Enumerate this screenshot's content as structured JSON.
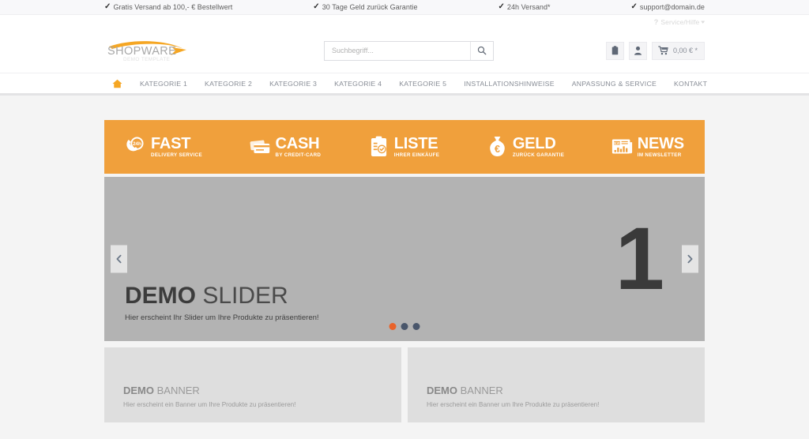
{
  "topbar": {
    "promos": [
      {
        "icon": "check-icon",
        "text": "Gratis Versand ab 100,- € Bestellwert"
      },
      {
        "icon": "check-icon",
        "text": "30 Tage Geld zurück Garantie"
      },
      {
        "icon": "check-icon",
        "text": "24h Versand*"
      },
      {
        "icon": "check-icon",
        "text": "support@domain.de"
      }
    ],
    "service_label": "Service/Hilfe",
    "service_icon": "question-mark-icon",
    "service_chevron": "chevron-down-icon"
  },
  "header": {
    "logo": {
      "name": "SHOPWARE",
      "tagline": "DEMO TEMPLATE",
      "accent": "#f5a623"
    },
    "search": {
      "placeholder": "Suchbegriff...",
      "value": "",
      "icon": "search-icon"
    },
    "actions": [
      {
        "icon": "note-clipboard-icon",
        "label": "Merkzettel"
      },
      {
        "icon": "user-account-icon",
        "label": "Mein Konto"
      }
    ],
    "cart": {
      "icon": "shopping-cart-icon",
      "amount": "0,00 € *"
    }
  },
  "nav": {
    "home_icon": "home-icon",
    "items": [
      {
        "label": "KATEGORIE 1"
      },
      {
        "label": "KATEGORIE 2"
      },
      {
        "label": "KATEGORIE 3"
      },
      {
        "label": "KATEGORIE 4"
      },
      {
        "label": "KATEGORIE 5"
      },
      {
        "label": "INSTALLATIONSHINWEISE"
      },
      {
        "label": "ANPASSUNG & SERVICE"
      },
      {
        "label": "KONTAKT"
      }
    ]
  },
  "benefits": {
    "background": "#f0a03c",
    "items": [
      {
        "icon": "phone-24h-icon",
        "title": "FAST",
        "subtitle": "DELIVERY SERVICE"
      },
      {
        "icon": "credit-card-icon",
        "title": "CASH",
        "subtitle": "BY CREDIT-CARD"
      },
      {
        "icon": "clipboard-check-icon",
        "title": "LISTE",
        "subtitle": "IHRER EINKÄUFE"
      },
      {
        "icon": "money-bag-euro-icon",
        "title": "GELD",
        "subtitle": "ZURÜCK GARANTIE"
      },
      {
        "icon": "newspaper-icon",
        "title": "NEWS",
        "subtitle": "IM NEWSLETTER"
      }
    ]
  },
  "slider": {
    "number": "1",
    "title_bold": "DEMO",
    "title_light": " SLIDER",
    "subtitle": "Hier erscheint Ihr Slider um Ihre Produkte zu präsentieren!",
    "prev_icon": "chevron-left-icon",
    "next_icon": "chevron-right-icon",
    "dots": [
      {
        "active": true,
        "color": "#e8632a"
      },
      {
        "active": false,
        "color": "#49566b"
      },
      {
        "active": false,
        "color": "#49566b"
      }
    ]
  },
  "banners": [
    {
      "title_bold": "DEMO",
      "title_light": " BANNER",
      "subtitle": "Hier erscheint ein Banner um Ihre Produkte zu präsentieren!"
    },
    {
      "title_bold": "DEMO",
      "title_light": " BANNER",
      "subtitle": "Hier erscheint ein Banner um Ihre Produkte zu präsentieren!"
    }
  ]
}
